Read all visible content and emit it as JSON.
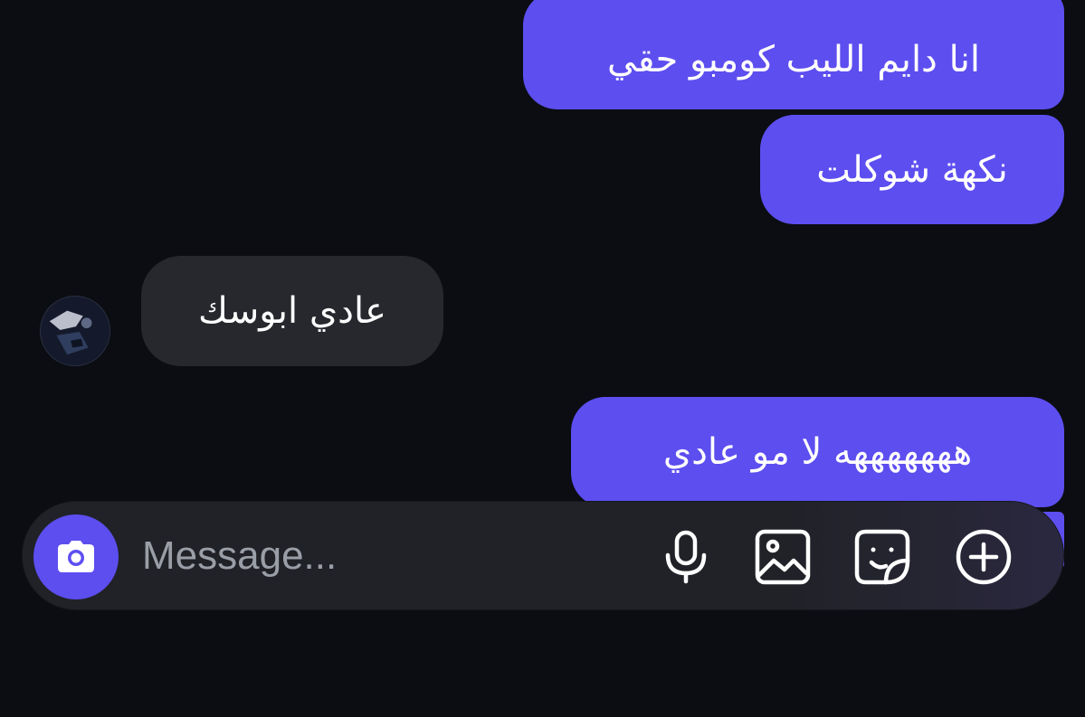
{
  "messages": [
    {
      "side": "sent",
      "text": "انا دايم الليب كومبو حقي"
    },
    {
      "side": "sent",
      "text": "نكهة شوكلت"
    },
    {
      "side": "received",
      "text": "عادي ابوسك"
    },
    {
      "side": "sent",
      "text": "هههههههه لا مو عادي"
    }
  ],
  "composer": {
    "placeholder": "Message...",
    "camera_icon": "camera-icon",
    "mic_icon": "microphone-icon",
    "gallery_icon": "image-gallery-icon",
    "sticker_icon": "sticker-icon",
    "plus_icon": "plus-circle-icon"
  },
  "colors": {
    "background": "#0b0d12",
    "sent_bubble": "#5d4ef0",
    "received_bubble": "#26282d",
    "composer": "#202227",
    "placeholder": "#9a9ea7"
  }
}
